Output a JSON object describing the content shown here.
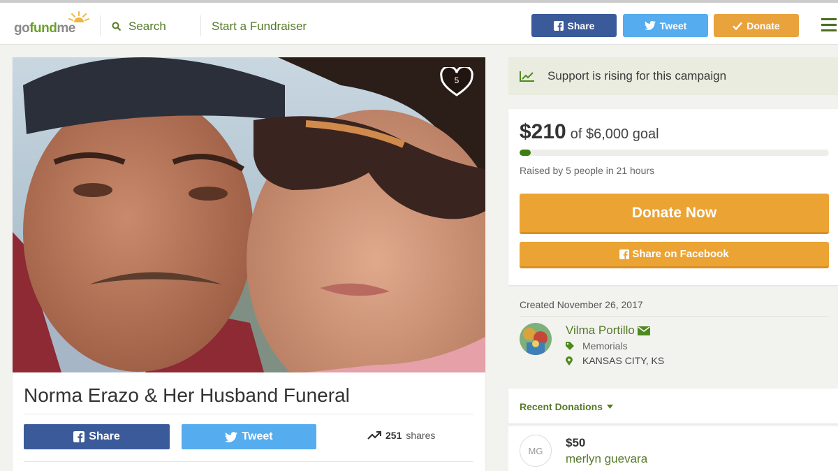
{
  "header": {
    "logo_text_a": "go",
    "logo_text_b": "fund",
    "logo_text_c": "me",
    "search_label": "Search",
    "start_label": "Start a Fundraiser",
    "share_label": "Share",
    "tweet_label": "Tweet",
    "donate_label": "Donate"
  },
  "campaign": {
    "heart_count": "5",
    "title": "Norma Erazo & Her Husband Funeral",
    "share_label": "Share",
    "tweet_label": "Tweet",
    "shares_count": "251",
    "shares_label": "shares"
  },
  "sidebar": {
    "rising_text": "Support is rising for this campaign",
    "amount": "$210",
    "goal_text": "of $6,000 goal",
    "progress_fraction": 0.035,
    "raised_by": "Raised by 5 people in 21 hours",
    "donate_now_label": "Donate Now",
    "share_fb_label": "Share on Facebook",
    "created": "Created November 26, 2017",
    "organizer_name": "Vilma Portillo",
    "category": "Memorials",
    "location": "KANSAS CITY, KS",
    "recent_donations_label": "Recent Donations",
    "donation": {
      "initials": "MG",
      "amount": "$50",
      "name": "merlyn guevara"
    }
  },
  "colors": {
    "brand_green": "#557a27",
    "facebook": "#3b5a99",
    "twitter": "#55acee",
    "donate_orange": "#eba333"
  }
}
